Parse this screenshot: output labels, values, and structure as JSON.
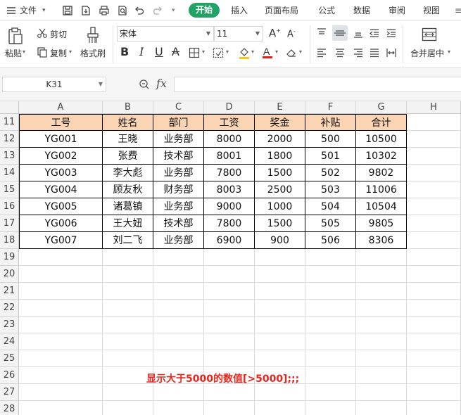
{
  "menubar": {
    "file_label": "文件",
    "tabs": [
      {
        "label": "开始",
        "active": true
      },
      {
        "label": "插入"
      },
      {
        "label": "页面布局"
      },
      {
        "label": "公式"
      },
      {
        "label": "数据"
      },
      {
        "label": "审阅"
      },
      {
        "label": "视图"
      }
    ],
    "accent_color": "#21a366"
  },
  "ribbon": {
    "paste_label": "粘贴",
    "cut_label": "剪切",
    "copy_label": "复制",
    "format_painter_label": "格式刷",
    "font_name": "宋体",
    "font_size": "11",
    "merge_center_label": "合并居中",
    "icons": [
      "paste-icon",
      "cut-icon",
      "copy-icon",
      "format-painter-icon",
      "bold-icon",
      "italic-icon",
      "underline-icon",
      "strikethrough-icon",
      "border-icon",
      "fill-icon",
      "font-color-icon",
      "clear-icon",
      "align-icon",
      "merge-icon"
    ]
  },
  "formula_bar": {
    "name_box": "K31",
    "fx_label": "fx",
    "formula": ""
  },
  "sheet": {
    "columns": [
      "A",
      "B",
      "C",
      "D",
      "E",
      "F",
      "G",
      "H"
    ],
    "rows": [
      "11",
      "12",
      "13",
      "14",
      "15",
      "16",
      "17",
      "18",
      "19",
      "20",
      "21",
      "22",
      "23",
      "24",
      "25",
      "26",
      "27",
      "28"
    ],
    "table_header": [
      "工号",
      "姓名",
      "部门",
      "工资",
      "奖金",
      "补贴",
      "合计"
    ],
    "table_rows": [
      [
        "YG001",
        "王晓",
        "业务部",
        "8000",
        "2000",
        "500",
        "10500"
      ],
      [
        "YG002",
        "张费",
        "技术部",
        "8001",
        "1800",
        "501",
        "10302"
      ],
      [
        "YG003",
        "李大彪",
        "业务部",
        "7800",
        "1500",
        "502",
        "9802"
      ],
      [
        "YG004",
        "顾友秋",
        "财务部",
        "8003",
        "2500",
        "503",
        "11006"
      ],
      [
        "YG005",
        "诸葛镇",
        "业务部",
        "9000",
        "1000",
        "504",
        "10504"
      ],
      [
        "YG006",
        "王大妞",
        "技术部",
        "7800",
        "1500",
        "505",
        "9805"
      ],
      [
        "YG007",
        "刘二飞",
        "业务部",
        "6900",
        "900",
        "506",
        "8306"
      ]
    ],
    "header_fill": "#fbd4b4",
    "annotation": "显示大于5000的数值[>5000];;;",
    "annotation_color": "#e8261e"
  }
}
